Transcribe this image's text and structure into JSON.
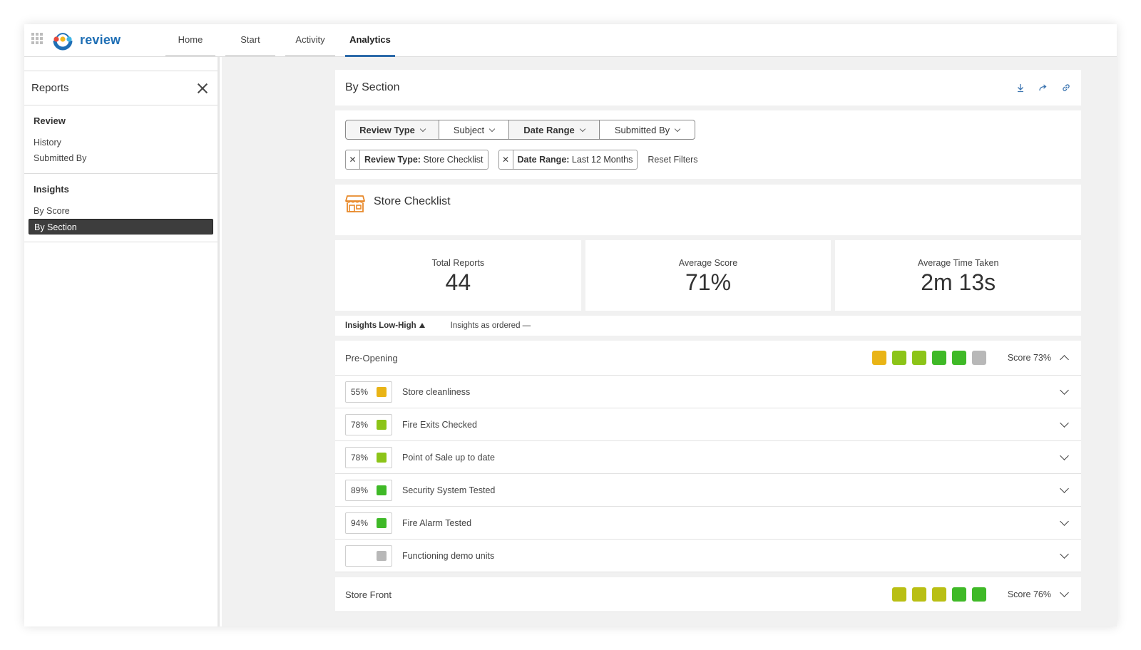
{
  "app": {
    "logo_text": "review"
  },
  "nav": {
    "tabs": [
      {
        "label": "Home"
      },
      {
        "label": "Start"
      },
      {
        "label": "Activity"
      },
      {
        "label": "Analytics"
      }
    ]
  },
  "sidebar": {
    "title": "Reports",
    "sections": [
      {
        "title": "Review",
        "items": [
          "History",
          "Submitted By"
        ]
      },
      {
        "title": "Insights",
        "items": [
          "By Score",
          "By Section"
        ]
      }
    ]
  },
  "panel": {
    "title": "By Section"
  },
  "filters": {
    "dropdowns": [
      "Review Type",
      "Subject",
      "Date Range",
      "Submitted By"
    ],
    "chips": [
      {
        "key": "Review Type:",
        "value": " Store Checklist"
      },
      {
        "key": "Date Range:",
        "value": " Last 12 Months"
      }
    ],
    "reset_label": "Reset Filters"
  },
  "checklist": {
    "title": "Store Checklist",
    "icon": "store-icon"
  },
  "stats": [
    {
      "label": "Total Reports",
      "value": "44"
    },
    {
      "label": "Average Score",
      "value": "71%"
    },
    {
      "label": "Average Time Taken",
      "value": "2m 13s"
    }
  ],
  "sort": {
    "primary": "Insights Low-High",
    "secondary": "Insights as ordered —"
  },
  "colors": {
    "yellow": "#e9b416",
    "yellow_green": "#8cc418",
    "green": "#3fb927",
    "olive": "#b9bf14",
    "grey": "#b8b8b8",
    "accent": "#2c6aa9"
  },
  "sections": [
    {
      "name": "Pre-Opening",
      "score": "Score 73%",
      "dots": [
        "#e9b416",
        "#8cc418",
        "#8cc418",
        "#3fb927",
        "#3fb927",
        "#b8b8b8"
      ],
      "rows": [
        {
          "pct": "55%",
          "color": "#e9b416",
          "label": "Store cleanliness"
        },
        {
          "pct": "78%",
          "color": "#8cc418",
          "label": "Fire Exits Checked"
        },
        {
          "pct": "78%",
          "color": "#8cc418",
          "label": "Point of Sale up to date"
        },
        {
          "pct": "89%",
          "color": "#3fb927",
          "label": "Security System Tested"
        },
        {
          "pct": "94%",
          "color": "#3fb927",
          "label": "Fire Alarm Tested"
        },
        {
          "pct": "",
          "color": "#b8b8b8",
          "label": "Functioning demo units"
        }
      ]
    },
    {
      "name": "Store Front",
      "score": "Score 76%",
      "dots": [
        "#b9bf14",
        "#b9bf14",
        "#b9bf14",
        "#3fb927",
        "#3fb927"
      ]
    }
  ]
}
